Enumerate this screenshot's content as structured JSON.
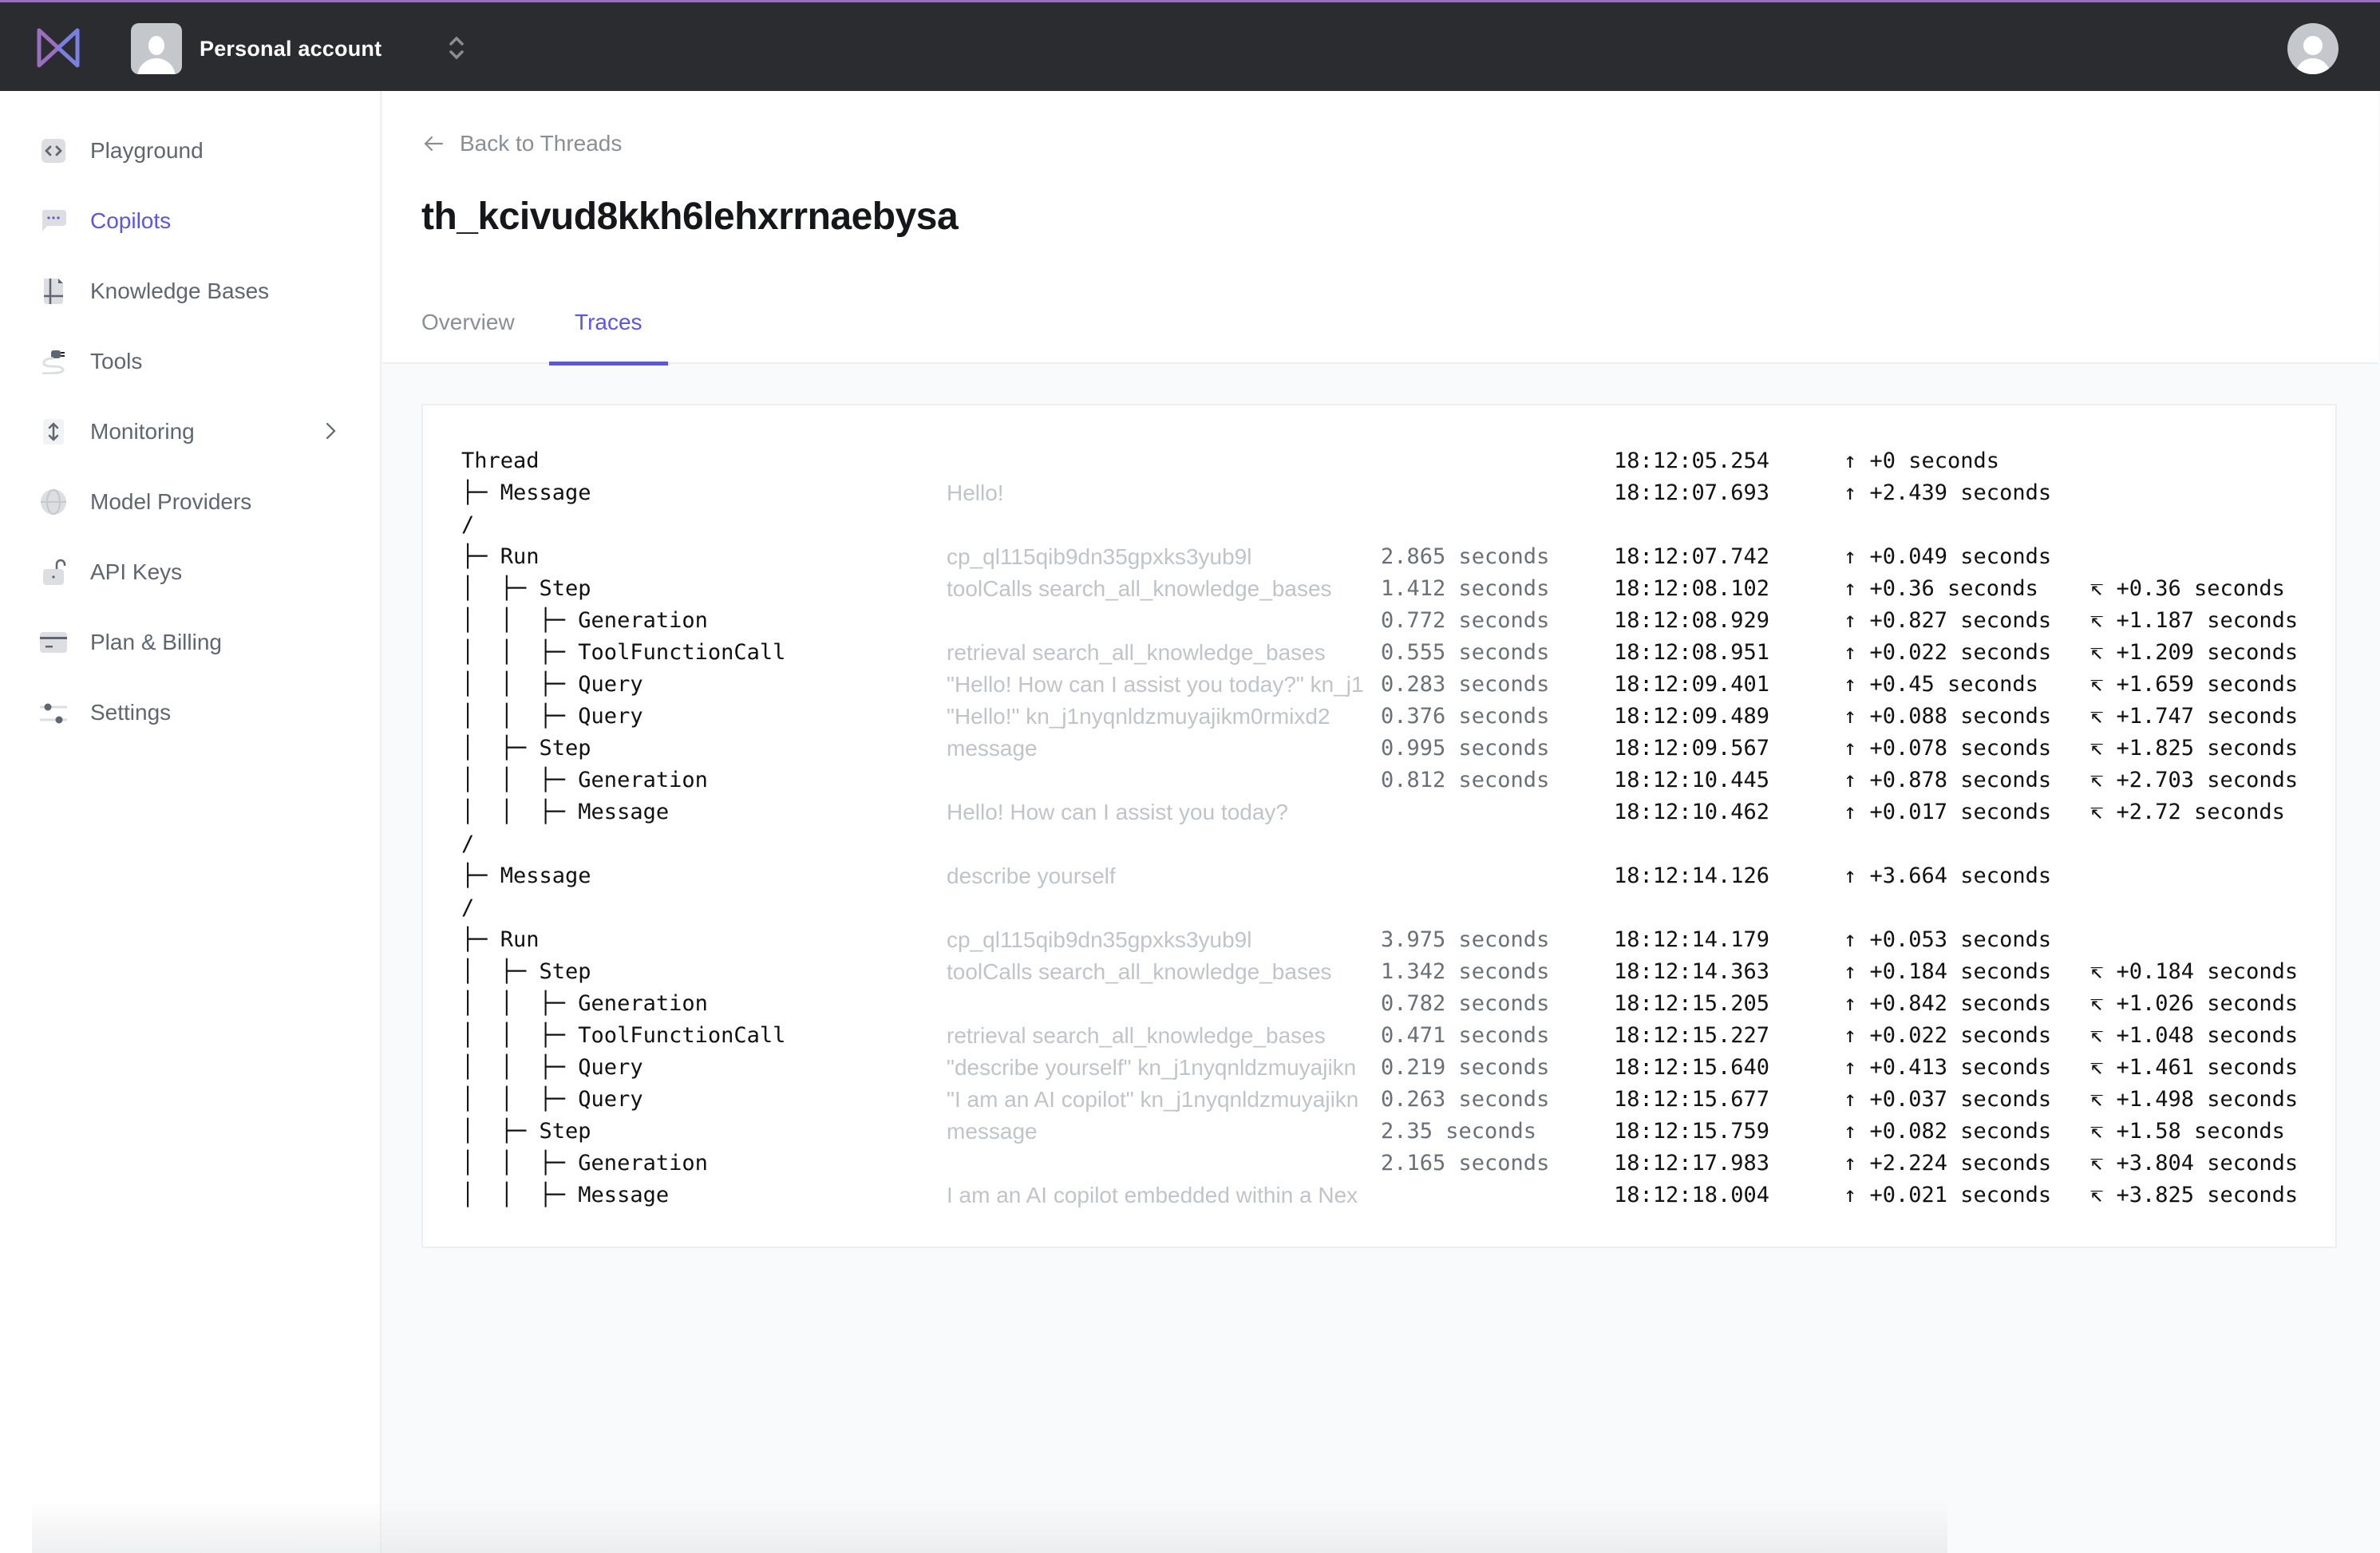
{
  "topbar": {
    "logo": "bowtie-logo",
    "account_name": "Personal account",
    "switch_icon": "chevron-up-down-icon",
    "user_avatar": "user-avatar-icon"
  },
  "sidebar": {
    "items": [
      {
        "label": "Playground",
        "icon": "code-icon",
        "active": false
      },
      {
        "label": "Copilots",
        "icon": "chat-bubble-icon",
        "active": true
      },
      {
        "label": "Knowledge Bases",
        "icon": "document-icon",
        "active": false
      },
      {
        "label": "Tools",
        "icon": "plug-icon",
        "active": false
      },
      {
        "label": "Monitoring",
        "icon": "arrows-vertical-icon",
        "active": false,
        "has_submenu": true
      },
      {
        "label": "Model Providers",
        "icon": "globe-icon",
        "active": false
      },
      {
        "label": "API Keys",
        "icon": "unlock-icon",
        "active": false
      },
      {
        "label": "Plan & Billing",
        "icon": "credit-card-icon",
        "active": false
      },
      {
        "label": "Settings",
        "icon": "sliders-icon",
        "active": false
      }
    ]
  },
  "main": {
    "back_label": "Back to Threads",
    "title": "th_kcivud8kkh6lehxrrnaebysa",
    "tabs": [
      {
        "label": "Overview",
        "active": false
      },
      {
        "label": "Traces",
        "active": true
      }
    ],
    "traces": [
      {
        "tree": "Thread",
        "desc": "",
        "duration": "",
        "time": "18:12:05.254",
        "delta": "↑ +0 seconds",
        "cumulative": ""
      },
      {
        "tree": "├─ Message",
        "desc": "Hello!",
        "duration": "",
        "time": "18:12:07.693",
        "delta": "↑ +2.439 seconds",
        "cumulative": ""
      },
      {
        "tree": "/",
        "desc": "",
        "duration": "",
        "time": "",
        "delta": "",
        "cumulative": ""
      },
      {
        "tree": "├─ Run",
        "desc": "cp_ql115qib9dn35gpxks3yub9l",
        "duration": "2.865 seconds",
        "time": "18:12:07.742",
        "delta": "↑ +0.049 seconds",
        "cumulative": ""
      },
      {
        "tree": "│  ├─ Step",
        "desc": "toolCalls search_all_knowledge_bases",
        "duration": "1.412 seconds",
        "time": "18:12:08.102",
        "delta": "↑ +0.36 seconds",
        "cumulative": "↸ +0.36 seconds"
      },
      {
        "tree": "│  │  ├─ Generation",
        "desc": "",
        "duration": "0.772 seconds",
        "time": "18:12:08.929",
        "delta": "↑ +0.827 seconds",
        "cumulative": "↸ +1.187 seconds"
      },
      {
        "tree": "│  │  ├─ ToolFunctionCall",
        "desc": "retrieval search_all_knowledge_bases",
        "duration": "0.555 seconds",
        "time": "18:12:08.951",
        "delta": "↑ +0.022 seconds",
        "cumulative": "↸ +1.209 seconds"
      },
      {
        "tree": "│  │  ├─ Query",
        "desc": "\"Hello! How can I assist you today?\" kn_j1",
        "duration": "0.283 seconds",
        "time": "18:12:09.401",
        "delta": "↑ +0.45 seconds",
        "cumulative": "↸ +1.659 seconds"
      },
      {
        "tree": "│  │  ├─ Query",
        "desc": "\"Hello!\" kn_j1nyqnldzmuyajikm0rmixd2",
        "duration": "0.376 seconds",
        "time": "18:12:09.489",
        "delta": "↑ +0.088 seconds",
        "cumulative": "↸ +1.747 seconds"
      },
      {
        "tree": "│  ├─ Step",
        "desc": "message",
        "duration": "0.995 seconds",
        "time": "18:12:09.567",
        "delta": "↑ +0.078 seconds",
        "cumulative": "↸ +1.825 seconds"
      },
      {
        "tree": "│  │  ├─ Generation",
        "desc": "",
        "duration": "0.812 seconds",
        "time": "18:12:10.445",
        "delta": "↑ +0.878 seconds",
        "cumulative": "↸ +2.703 seconds"
      },
      {
        "tree": "│  │  ├─ Message",
        "desc": "Hello! How can I assist you today?",
        "duration": "",
        "time": "18:12:10.462",
        "delta": "↑ +0.017 seconds",
        "cumulative": "↸ +2.72 seconds"
      },
      {
        "tree": "/",
        "desc": "",
        "duration": "",
        "time": "",
        "delta": "",
        "cumulative": ""
      },
      {
        "tree": "├─ Message",
        "desc": "describe yourself",
        "duration": "",
        "time": "18:12:14.126",
        "delta": "↑ +3.664 seconds",
        "cumulative": ""
      },
      {
        "tree": "/",
        "desc": "",
        "duration": "",
        "time": "",
        "delta": "",
        "cumulative": ""
      },
      {
        "tree": "├─ Run",
        "desc": "cp_ql115qib9dn35gpxks3yub9l",
        "duration": "3.975 seconds",
        "time": "18:12:14.179",
        "delta": "↑ +0.053 seconds",
        "cumulative": ""
      },
      {
        "tree": "│  ├─ Step",
        "desc": "toolCalls search_all_knowledge_bases",
        "duration": "1.342 seconds",
        "time": "18:12:14.363",
        "delta": "↑ +0.184 seconds",
        "cumulative": "↸ +0.184 seconds"
      },
      {
        "tree": "│  │  ├─ Generation",
        "desc": "",
        "duration": "0.782 seconds",
        "time": "18:12:15.205",
        "delta": "↑ +0.842 seconds",
        "cumulative": "↸ +1.026 seconds"
      },
      {
        "tree": "│  │  ├─ ToolFunctionCall",
        "desc": "retrieval search_all_knowledge_bases",
        "duration": "0.471 seconds",
        "time": "18:12:15.227",
        "delta": "↑ +0.022 seconds",
        "cumulative": "↸ +1.048 seconds"
      },
      {
        "tree": "│  │  ├─ Query",
        "desc": "\"describe yourself\" kn_j1nyqnldzmuyajikn",
        "duration": "0.219 seconds",
        "time": "18:12:15.640",
        "delta": "↑ +0.413 seconds",
        "cumulative": "↸ +1.461 seconds"
      },
      {
        "tree": "│  │  ├─ Query",
        "desc": "\"I am an AI copilot\" kn_j1nyqnldzmuyajikn",
        "duration": "0.263 seconds",
        "time": "18:12:15.677",
        "delta": "↑ +0.037 seconds",
        "cumulative": "↸ +1.498 seconds"
      },
      {
        "tree": "│  ├─ Step",
        "desc": "message",
        "duration": "2.35 seconds",
        "time": "18:12:15.759",
        "delta": "↑ +0.082 seconds",
        "cumulative": "↸ +1.58 seconds"
      },
      {
        "tree": "│  │  ├─ Generation",
        "desc": "",
        "duration": "2.165 seconds",
        "time": "18:12:17.983",
        "delta": "↑ +2.224 seconds",
        "cumulative": "↸ +3.804 seconds"
      },
      {
        "tree": "│  │  ├─ Message",
        "desc": "I am an AI copilot embedded within a Nex",
        "duration": "",
        "time": "18:12:18.004",
        "delta": "↑ +0.021 seconds",
        "cumulative": "↸ +3.825 seconds"
      }
    ]
  },
  "colors": {
    "accent": "#5b55e8",
    "topbar": "#2b2c30",
    "logo": "#9b6fc0"
  }
}
